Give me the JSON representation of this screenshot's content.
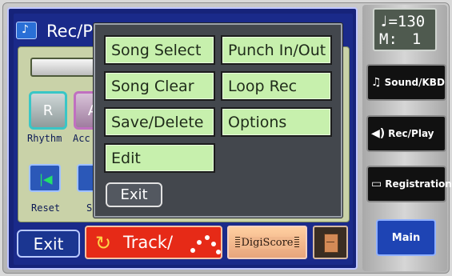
{
  "screen": {
    "title": "Rec/Pl"
  },
  "background": {
    "parts": [
      {
        "letter": "R",
        "label": "Rhythm"
      },
      {
        "letter": "A",
        "label": "Acc"
      }
    ],
    "transport": [
      {
        "icon": "skip-to-start-icon",
        "label": "Reset"
      },
      {
        "label": "S"
      }
    ]
  },
  "popup": {
    "items": [
      {
        "id": "song-select",
        "label": "Song Select"
      },
      {
        "id": "punch-in-out",
        "label": "Punch In/Out"
      },
      {
        "id": "song-clear",
        "label": "Song Clear"
      },
      {
        "id": "loop-rec",
        "label": "Loop Rec"
      },
      {
        "id": "save-delete",
        "label": "Save/Delete"
      },
      {
        "id": "options",
        "label": "Options"
      },
      {
        "id": "edit",
        "label": "Edit"
      }
    ],
    "exit_label": "Exit"
  },
  "bottom": {
    "exit_label": "Exit",
    "track_label": "Track/",
    "digiscore_label": "DigiScore"
  },
  "tempo": {
    "note": "♩=130",
    "measure_label": "M:",
    "measure_value": "1"
  },
  "side": {
    "sound_kbd": "Sound/KBD",
    "rec_play": "Rec/Play",
    "registration": "Registration",
    "main": "Main"
  },
  "colors": {
    "menu_green": "#c7f0ad",
    "track_red": "#e62a17",
    "main_blue": "#1e44b4"
  }
}
